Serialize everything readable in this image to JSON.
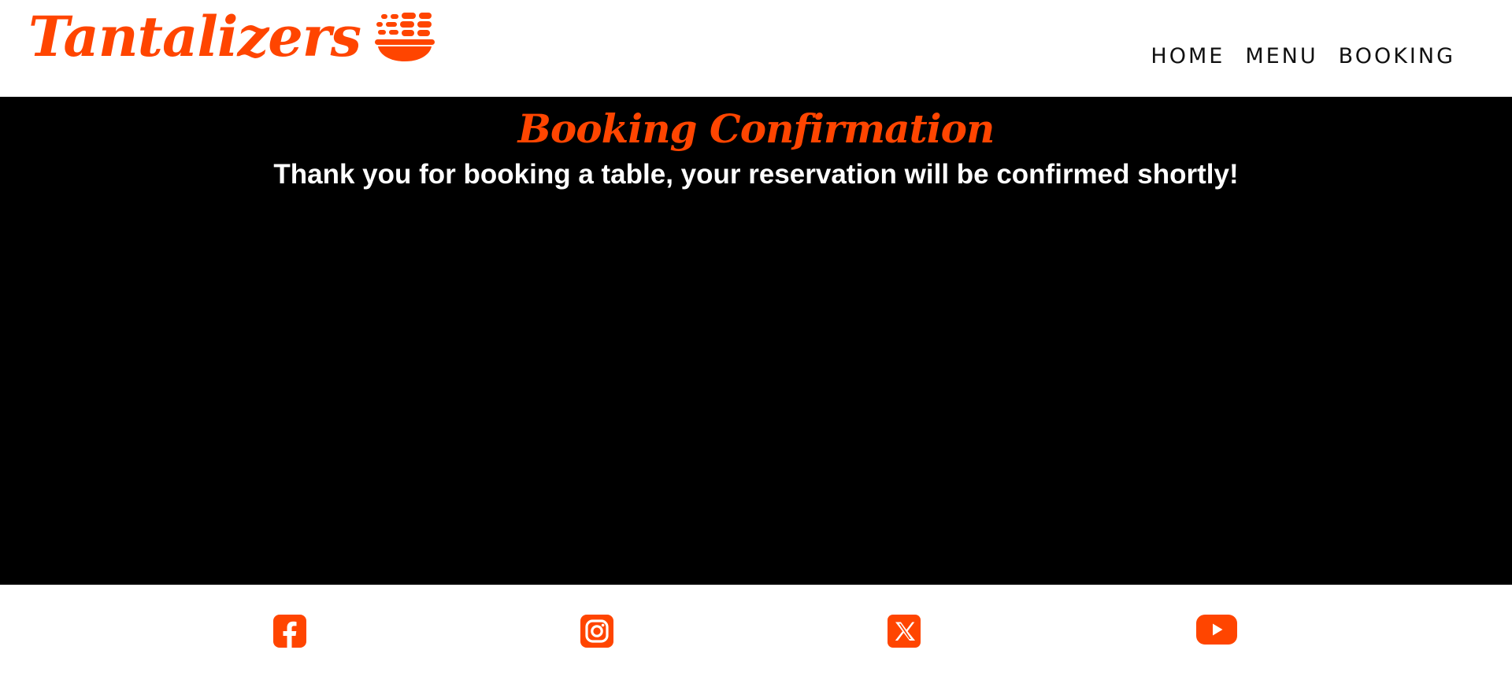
{
  "brand": {
    "name": "Tantalizers",
    "icon": "bowl-food-icon",
    "color": "#FF4500"
  },
  "nav": {
    "items": [
      {
        "label": "HOME"
      },
      {
        "label": "MENU"
      },
      {
        "label": "BOOKING"
      }
    ]
  },
  "main": {
    "title": "Booking Confirmation",
    "message": "Thank you for booking a table, your reservation will be confirmed shortly!",
    "background": "#000000"
  },
  "footer": {
    "social": [
      {
        "icon": "facebook-icon"
      },
      {
        "icon": "instagram-icon"
      },
      {
        "icon": "x-twitter-icon"
      },
      {
        "icon": "youtube-icon"
      }
    ],
    "icon_color": "#FF4500"
  }
}
